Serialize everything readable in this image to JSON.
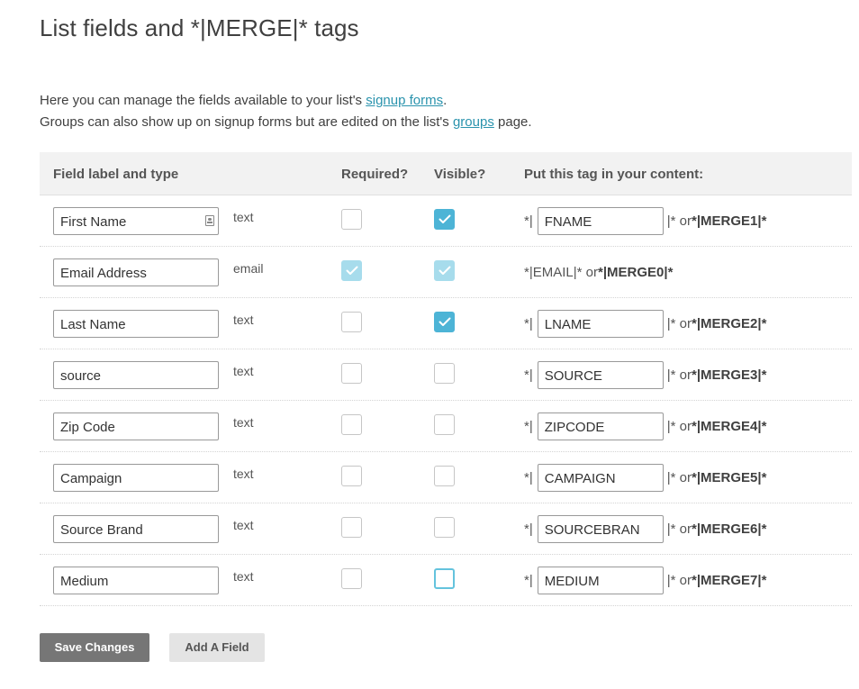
{
  "page": {
    "title": "List fields and *|MERGE|* tags",
    "intro_line1_prefix": "Here you can manage the fields available to your list's ",
    "intro_line1_link": "signup forms",
    "intro_line1_suffix": ".",
    "intro_line2_prefix": "Groups can also show up on signup forms but are edited on the list's ",
    "intro_line2_link": "groups",
    "intro_line2_suffix": " page."
  },
  "table": {
    "headers": {
      "label": "Field label and type",
      "required": "Required?",
      "visible": "Visible?",
      "tag": "Put this tag in your content:"
    },
    "rows": [
      {
        "label": "First Name",
        "type": "text",
        "required": "unchecked",
        "visible": "checked",
        "tag": "FNAME",
        "merge": "*|MERGE1|*",
        "contact_icon": true
      },
      {
        "label": "Email Address",
        "type": "email",
        "required": "checked-disabled",
        "visible": "checked-disabled",
        "tag_static": "*|EMAIL|* or ",
        "merge": "*|MERGE0|*"
      },
      {
        "label": "Last Name",
        "type": "text",
        "required": "unchecked",
        "visible": "checked",
        "tag": "LNAME",
        "merge": "*|MERGE2|*"
      },
      {
        "label": "source",
        "type": "text",
        "required": "unchecked",
        "visible": "unchecked",
        "tag": "SOURCE",
        "merge": "*|MERGE3|*"
      },
      {
        "label": "Zip Code",
        "type": "text",
        "required": "unchecked",
        "visible": "unchecked",
        "tag": "ZIPCODE",
        "merge": "*|MERGE4|*"
      },
      {
        "label": "Campaign",
        "type": "text",
        "required": "unchecked",
        "visible": "unchecked",
        "tag": "CAMPAIGN",
        "merge": "*|MERGE5|*"
      },
      {
        "label": "Source Brand",
        "type": "text",
        "required": "unchecked",
        "visible": "unchecked",
        "tag": "SOURCEBRAN",
        "merge": "*|MERGE6|*"
      },
      {
        "label": "Medium",
        "type": "text",
        "required": "unchecked",
        "visible": "focused",
        "tag": "MEDIUM",
        "merge": "*|MERGE7|*"
      }
    ],
    "tag_prefix": "*|",
    "tag_suffix_join": "|* or "
  },
  "buttons": {
    "save": "Save Changes",
    "add": "Add A Field"
  },
  "colors": {
    "checkbox_checked": "#4db4d6",
    "checkbox_disabled": "#a7dcec",
    "link": "#2a93ad",
    "primary_button": "#767676"
  },
  "icons": {
    "contact": "contact-card-icon",
    "check": "checkmark-icon"
  }
}
